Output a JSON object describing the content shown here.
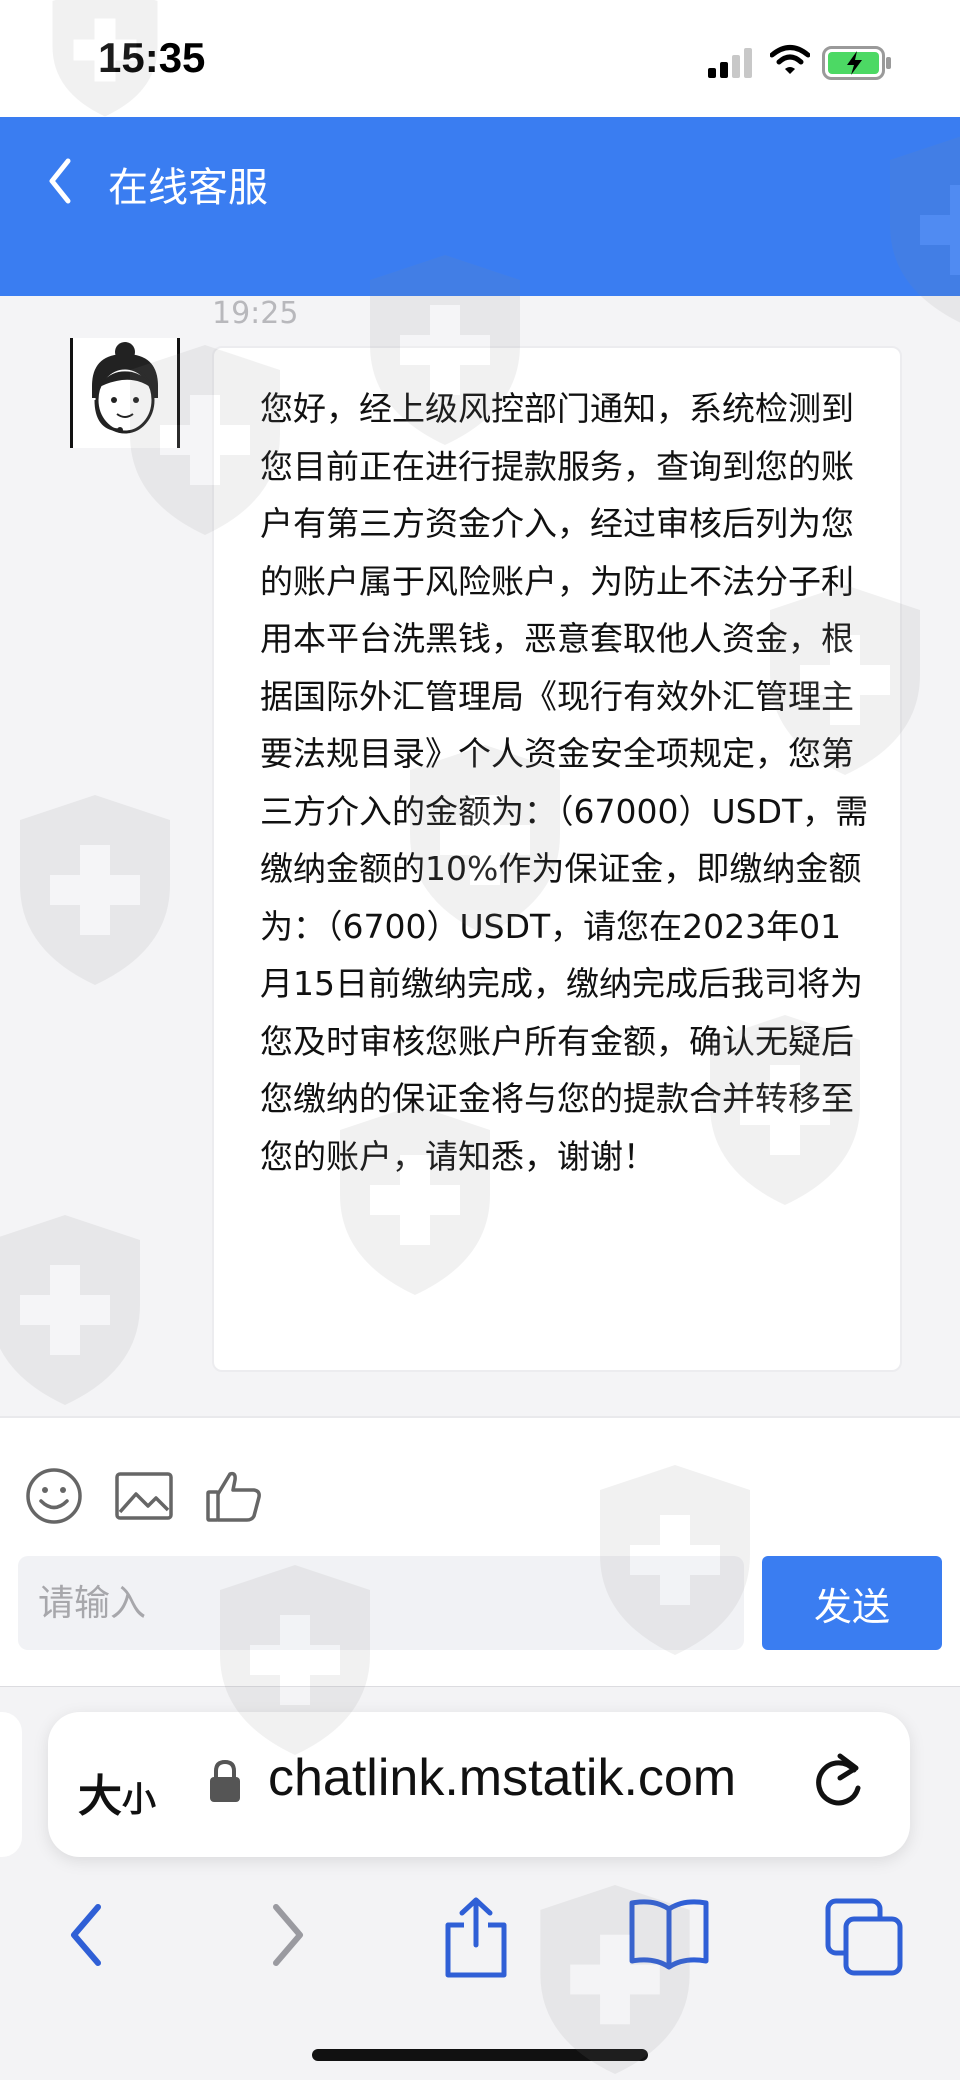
{
  "status_bar": {
    "time": "15:35"
  },
  "header": {
    "title": "在线客服"
  },
  "chat": {
    "messages": [
      {
        "time": "19:25",
        "text": "您好，经上级风控部门通知，系统检测到您目前正在进行提款服务，查询到您的账户有第三方资金介入，经过审核后列为您的账户属于风险账户，为防止不法分子利用本平台洗黑钱，恶意套取他人资金，根据国际外汇管理局《现行有效外汇管理主要法规目录》个人资金安全项规定，您第三方介入的金额为：（67000）USDT，需缴纳金额的10%作为保证金，即缴纳金额为：（6700）USDT，请您在2023年01月15日前缴纳完成，缴纳完成后我司将为您及时审核您账户所有金额，确认无疑后您缴纳的保证金将与您的提款合并转移至您的账户，请知悉，谢谢！"
      }
    ]
  },
  "input": {
    "placeholder": "请输入",
    "send_label": "发送"
  },
  "browser": {
    "aa_big": "大",
    "aa_small": "小",
    "url": "chatlink.mstatik.com"
  },
  "colors": {
    "accent": "#3a7df1",
    "browser_icon": "#2f5fd6"
  },
  "icons": [
    "back-chevron-icon",
    "emoji-icon",
    "image-icon",
    "thumbs-up-icon",
    "lock-icon",
    "reload-icon",
    "browser-back-icon",
    "browser-forward-icon",
    "share-icon",
    "bookmarks-icon",
    "tabs-icon"
  ]
}
